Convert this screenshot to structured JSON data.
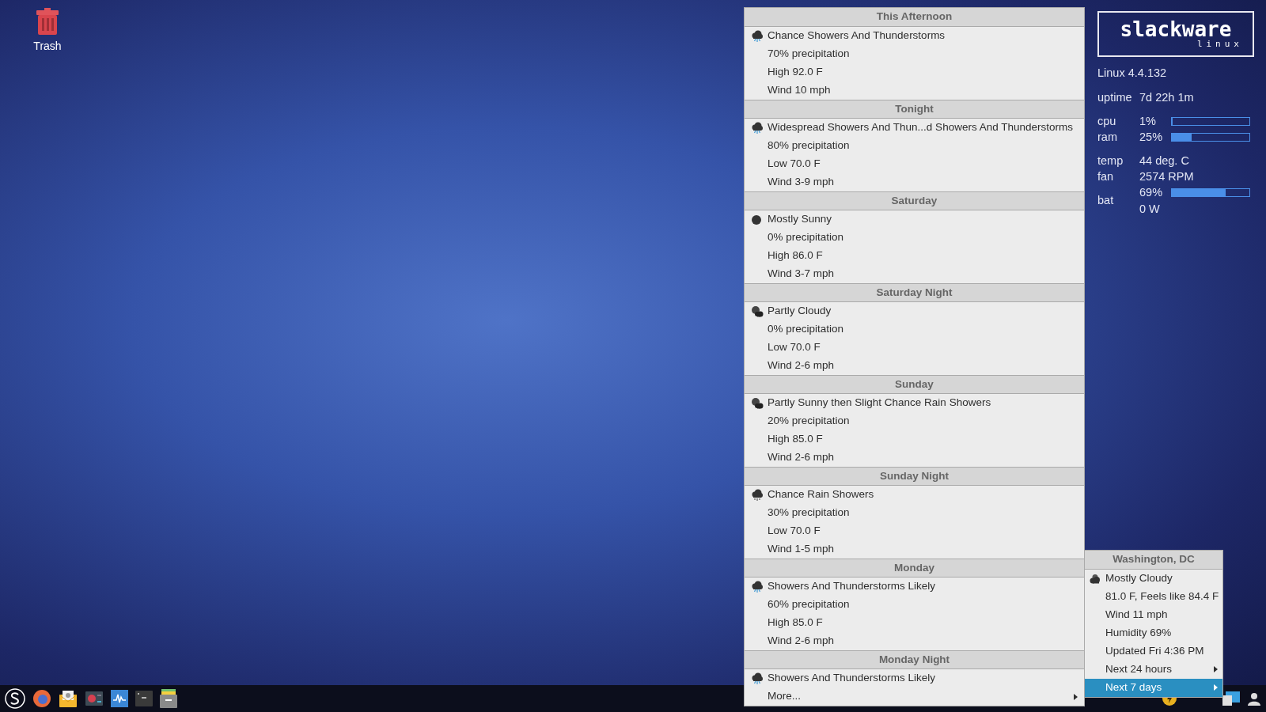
{
  "desktop_icons": [
    {
      "label": "Trash"
    }
  ],
  "conky": {
    "logo_main": "slackware",
    "logo_sub": "linux",
    "kernel": "Linux 4.4.132",
    "groups": [
      [
        {
          "label": "uptime",
          "value": "7d 22h 1m"
        }
      ],
      [
        {
          "label": "cpu",
          "value": "1%",
          "level": 0.01
        },
        {
          "label": "ram",
          "value": "25%",
          "level": 0.25
        }
      ],
      [
        {
          "label": "temp",
          "value": "44 deg. C"
        },
        {
          "label": "fan",
          "value": "2574 RPM"
        }
      ],
      [
        {
          "label": "bat",
          "value": "69%",
          "level": 0.69,
          "extra": "0 W"
        }
      ]
    ]
  },
  "forecast_menu": {
    "sections": [
      {
        "title": "This Afternoon",
        "kind": "storm",
        "lines": [
          "Chance Showers And Thunderstorms",
          "70% precipitation",
          "High 92.0 F",
          "Wind 10 mph"
        ]
      },
      {
        "title": "Tonight",
        "kind": "storm",
        "lines": [
          "Widespread Showers And Thun...d Showers And Thunderstorms",
          "80% precipitation",
          "Low 70.0 F",
          "Wind 3-9 mph"
        ]
      },
      {
        "title": "Saturday",
        "kind": "sun",
        "lines": [
          "Mostly Sunny",
          "0% precipitation",
          "High 86.0 F",
          "Wind 3-7 mph"
        ]
      },
      {
        "title": "Saturday Night",
        "kind": "partly",
        "lines": [
          "Partly Cloudy",
          "0% precipitation",
          "Low 70.0 F",
          "Wind 2-6 mph"
        ]
      },
      {
        "title": "Sunday",
        "kind": "partly",
        "lines": [
          "Partly Sunny then Slight Chance Rain Showers",
          "20% precipitation",
          "High 85.0 F",
          "Wind 2-6 mph"
        ]
      },
      {
        "title": "Sunday Night",
        "kind": "rain",
        "lines": [
          "Chance Rain Showers",
          "30% precipitation",
          "Low 70.0 F",
          "Wind 1-5 mph"
        ]
      },
      {
        "title": "Monday",
        "kind": "storm",
        "lines": [
          "Showers And Thunderstorms Likely",
          "60% precipitation",
          "High 85.0 F",
          "Wind 2-6 mph"
        ]
      },
      {
        "title": "Monday Night",
        "kind": "storm",
        "lines": [
          "Showers And Thunderstorms Likely"
        ]
      }
    ],
    "more": "More..."
  },
  "current_menu": {
    "title": "Washington, DC",
    "items": [
      {
        "text": "Mostly Cloudy",
        "kind": "cloudy",
        "submenu": false,
        "selected": false
      },
      {
        "text": "81.0 F, Feels like 84.4 F",
        "submenu": false,
        "selected": false
      },
      {
        "text": "Wind 11 mph",
        "submenu": false,
        "selected": false
      },
      {
        "text": "Humidity 69%",
        "submenu": false,
        "selected": false
      },
      {
        "text": "Updated Fri 4:36 PM",
        "submenu": false,
        "selected": false
      },
      {
        "text": "Next 24 hours",
        "submenu": true,
        "selected": false
      },
      {
        "text": "Next 7 days",
        "submenu": true,
        "selected": true
      }
    ]
  }
}
